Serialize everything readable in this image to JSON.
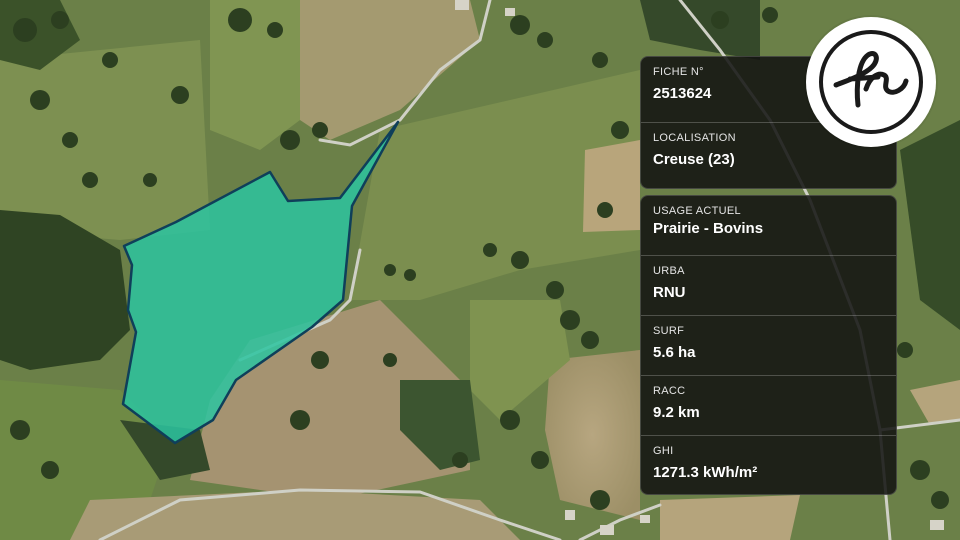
{
  "map": {
    "parcel_color": "#2cc4a0",
    "parcel_border_color": "#0f3f5a"
  },
  "logo": {
    "icon": "fs-monogram-logo",
    "text": "fs"
  },
  "sheet": [
    {
      "label": "FICHE N°",
      "value": "2513624"
    },
    {
      "label": "LOCALISATION",
      "value": "Creuse (23)"
    }
  ],
  "details": [
    {
      "label": "USAGE ACTUEL",
      "value": "Prairie - Bovins"
    },
    {
      "label": "URBA",
      "value": "RNU"
    },
    {
      "label": "SURF",
      "value": "5.6 ha"
    },
    {
      "label": "RACC",
      "value": "9.2 km"
    },
    {
      "label": "GHI",
      "value": "1271.3 kWh/m²"
    }
  ]
}
